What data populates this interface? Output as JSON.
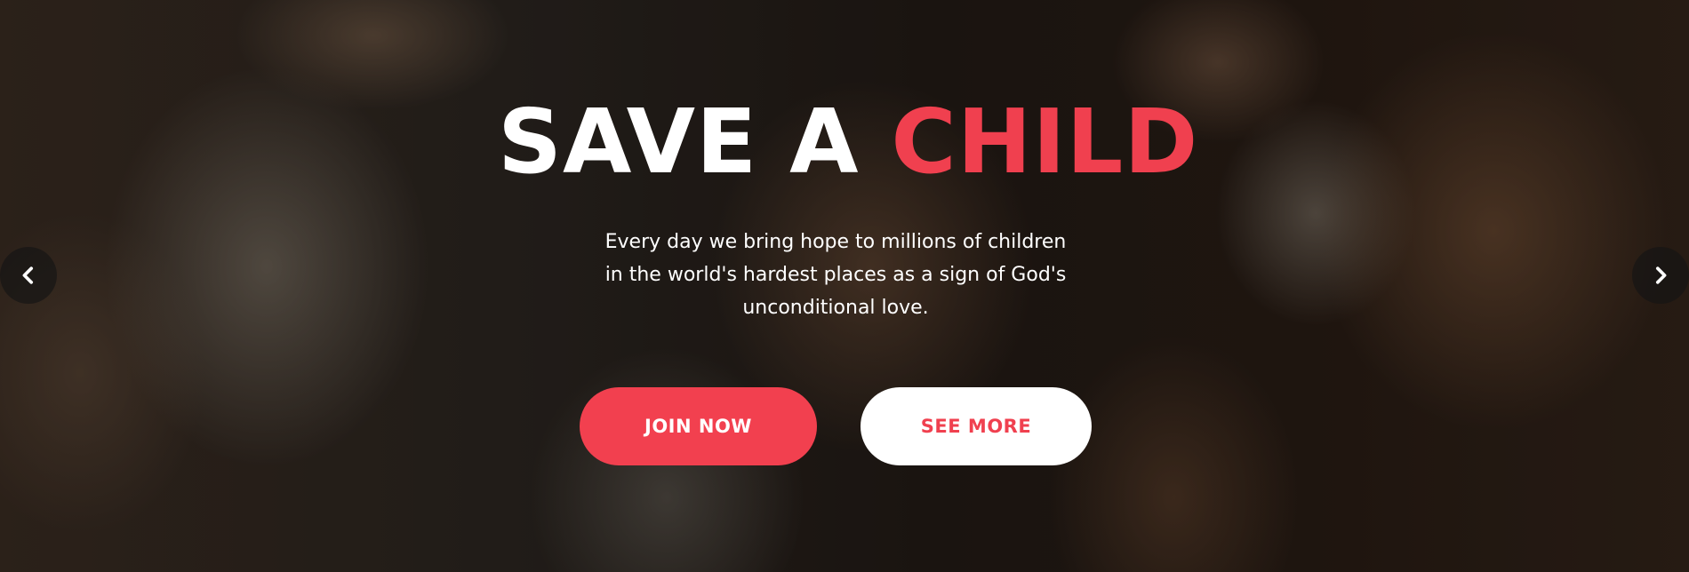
{
  "hero": {
    "title_part1": "SAVE A",
    "title_part2": "CHILD",
    "subtitle_line1": "Every day we bring hope to millions of children",
    "subtitle_line2": "in the world's hardest places as a sign of God's",
    "subtitle_line3": "unconditional love.",
    "join_label": "JOIN NOW",
    "more_label": "SEE MORE"
  },
  "slider": {
    "prev_icon": "chevron-left-icon",
    "next_icon": "chevron-right-icon"
  },
  "colors": {
    "accent": "#f0404f",
    "text": "#ffffff"
  }
}
